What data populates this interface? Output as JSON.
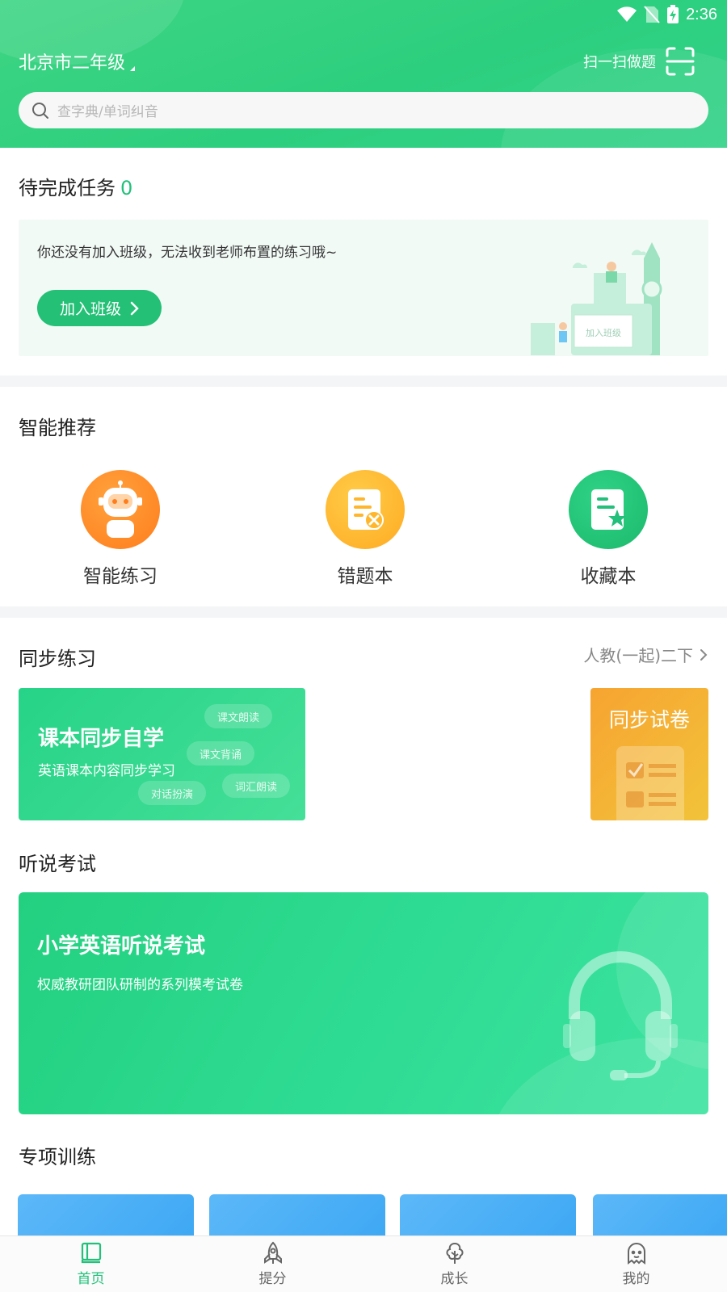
{
  "status_bar": {
    "time": "2:36"
  },
  "header": {
    "location": "北京市二年级",
    "scan_label": "扫一扫做题",
    "search_placeholder": "查字典/单词纠音"
  },
  "pending": {
    "title": "待完成任务",
    "count": "0",
    "message": "你还没有加入班级，无法收到老师布置的练习哦~",
    "join_button": "加入班级",
    "illustration_text": "加入班级"
  },
  "recommend": {
    "title": "智能推荐",
    "items": [
      {
        "label": "智能练习",
        "icon": "robot-icon",
        "color": "#ff8a24"
      },
      {
        "label": "错题本",
        "icon": "wrong-notebook-icon",
        "color": "#ffb62a"
      },
      {
        "label": "收藏本",
        "icon": "favorites-notebook-icon",
        "color": "#22c07a"
      }
    ]
  },
  "sync": {
    "title": "同步练习",
    "textbook": "人教(一起)二下",
    "card_main": {
      "title": "课本同步自学",
      "subtitle": "英语课本内容同步学习",
      "chips": [
        "课文朗读",
        "课文背诵",
        "词汇朗读",
        "对话扮演"
      ]
    },
    "card_side": {
      "title": "同步试卷"
    }
  },
  "exam": {
    "title": "听说考试",
    "card_title": "小学英语听说考试",
    "card_subtitle": "权威教研团队研制的系列模考试卷"
  },
  "special": {
    "title": "专项训练"
  },
  "bottom_nav": [
    {
      "label": "首页",
      "icon": "book-icon",
      "active": true
    },
    {
      "label": "提分",
      "icon": "rocket-icon",
      "active": false
    },
    {
      "label": "成长",
      "icon": "tree-icon",
      "active": false
    },
    {
      "label": "我的",
      "icon": "ghost-icon",
      "active": false
    }
  ],
  "colors": {
    "brand_green": "#22c07a",
    "orange": "#ff8a24",
    "yellow": "#ffb62a",
    "blue": "#4aaef6"
  }
}
